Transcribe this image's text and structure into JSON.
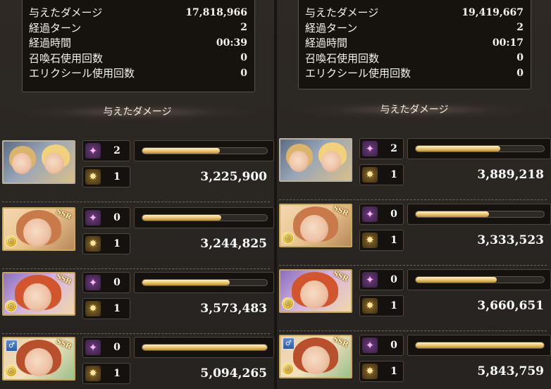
{
  "panels": [
    {
      "summary": [
        {
          "label": "与えたダメージ",
          "value": "17,818,966"
        },
        {
          "label": "経過ターン",
          "value": "2"
        },
        {
          "label": "経過時間",
          "value": "00:39"
        },
        {
          "label": "召喚石使用回数",
          "value": "0"
        },
        {
          "label": "エリクシール使用回数",
          "value": "0"
        }
      ],
      "section_title": "与えたダメージ",
      "characters": [
        {
          "ca_count": "2",
          "skill_count": "1",
          "bar": 0.62,
          "damage": "3,225,900"
        },
        {
          "ca_count": "0",
          "skill_count": "1",
          "bar": 0.63,
          "damage": "3,244,825"
        },
        {
          "ca_count": "0",
          "skill_count": "1",
          "bar": 0.7,
          "damage": "3,573,483"
        },
        {
          "ca_count": "0",
          "skill_count": "1",
          "bar": 1.0,
          "damage": "5,094,265"
        }
      ]
    },
    {
      "summary": [
        {
          "label": "与えたダメージ",
          "value": "19,419,667"
        },
        {
          "label": "経過ターン",
          "value": "2"
        },
        {
          "label": "経過時間",
          "value": "00:17"
        },
        {
          "label": "召喚石使用回数",
          "value": "0"
        },
        {
          "label": "エリクシール使用回数",
          "value": "0"
        }
      ],
      "section_title": "与えたダメージ",
      "characters": [
        {
          "ca_count": "2",
          "skill_count": "1",
          "bar": 0.66,
          "damage": "3,889,218"
        },
        {
          "ca_count": "0",
          "skill_count": "1",
          "bar": 0.57,
          "damage": "3,333,523"
        },
        {
          "ca_count": "0",
          "skill_count": "1",
          "bar": 0.63,
          "damage": "3,660,651"
        },
        {
          "ca_count": "0",
          "skill_count": "1",
          "bar": 1.0,
          "damage": "5,843,759"
        }
      ]
    }
  ],
  "icons": {
    "ca": "charge-attack-star-icon",
    "skill": "skill-burst-icon",
    "element": "element-badge-icon",
    "ssr": "SSR"
  }
}
